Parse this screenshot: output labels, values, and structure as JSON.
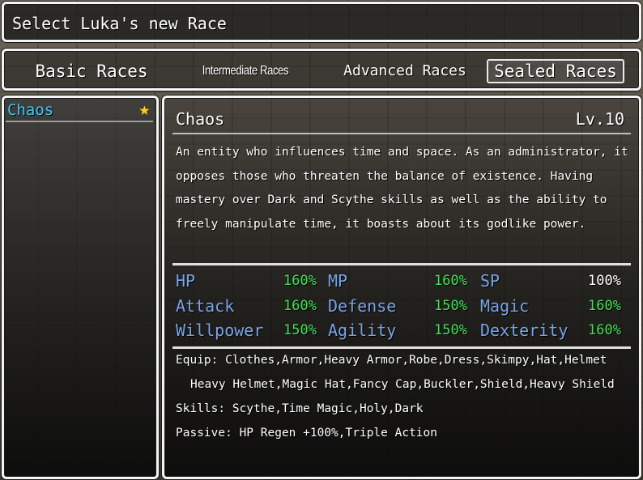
{
  "header": {
    "title": "Select Luka's new Race"
  },
  "tabs": [
    {
      "label": "Basic Races",
      "selected": false
    },
    {
      "label": "Intermediate Races",
      "selected": false
    },
    {
      "label": "Advanced Races",
      "selected": false
    },
    {
      "label": "Sealed Races",
      "selected": true
    }
  ],
  "race_list": {
    "items": [
      {
        "label": "Chaos",
        "icon": "star-icon",
        "icon_color": "#ffd21a",
        "label_color": "#42c8f4"
      }
    ]
  },
  "detail": {
    "name": "Chaos",
    "level": "Lv.10",
    "description_lines": [
      "An entity who influences time and space. As an administrator, it",
      "opposes those who threaten the balance of existence. Having",
      "mastery over Dark and Scythe skills as well as the ability to",
      "freely manipulate time, it boasts about its godlike power."
    ],
    "stats": [
      [
        {
          "name": "HP",
          "value": "160%",
          "color": "#44e05a"
        },
        {
          "name": "MP",
          "value": "160%",
          "color": "#44e05a"
        },
        {
          "name": "SP",
          "value": "100%",
          "color": "#ffffff"
        }
      ],
      [
        {
          "name": "Attack",
          "value": "160%",
          "color": "#44e05a"
        },
        {
          "name": "Defense",
          "value": "150%",
          "color": "#44e05a"
        },
        {
          "name": "Magic",
          "value": "160%",
          "color": "#44e05a"
        }
      ],
      [
        {
          "name": "Willpower",
          "value": "150%",
          "color": "#44e05a"
        },
        {
          "name": "Agility",
          "value": "150%",
          "color": "#44e05a"
        },
        {
          "name": "Dexterity",
          "value": "160%",
          "color": "#44e05a"
        }
      ]
    ],
    "equip_line1": "Equip: Clothes,Armor,Heavy Armor,Robe,Dress,Skimpy,Hat,Helmet",
    "equip_line2": "Heavy Helmet,Magic Hat,Fancy Cap,Buckler,Shield,Heavy Shield",
    "skills": "Skills: Scythe,Time Magic,Holy,Dark",
    "passive": "Passive: HP Regen +100%,Triple Action"
  },
  "colors": {
    "stat_name": "#7aa4e8",
    "stat_up": "#44e05a",
    "stat_neutral": "#ffffff",
    "frame": "#f4f4f4"
  }
}
